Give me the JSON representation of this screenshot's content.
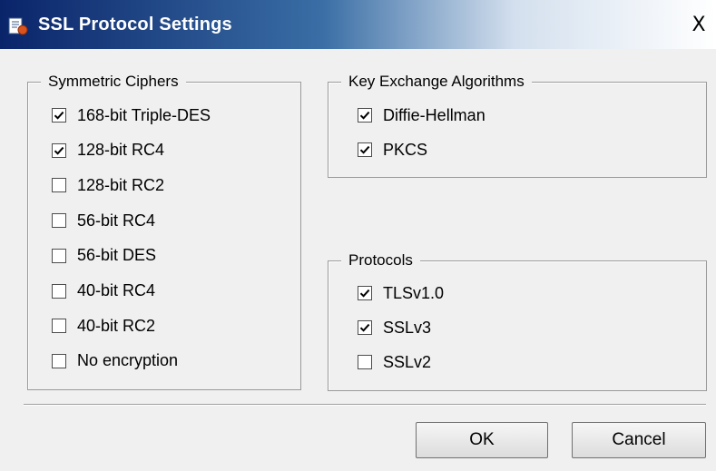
{
  "window": {
    "title": "SSL Protocol Settings",
    "close_label": "X"
  },
  "symmetric_ciphers": {
    "label": "Symmetric Ciphers",
    "options": [
      {
        "label": "168-bit Triple-DES",
        "checked": true
      },
      {
        "label": "128-bit RC4",
        "checked": true
      },
      {
        "label": "128-bit RC2",
        "checked": false
      },
      {
        "label": "56-bit RC4",
        "checked": false
      },
      {
        "label": "56-bit DES",
        "checked": false
      },
      {
        "label": "40-bit RC4",
        "checked": false
      },
      {
        "label": "40-bit RC2",
        "checked": false
      },
      {
        "label": "No encryption",
        "checked": false
      }
    ]
  },
  "key_exchange": {
    "label": "Key Exchange Algorithms",
    "options": [
      {
        "label": "Diffie-Hellman",
        "checked": true
      },
      {
        "label": "PKCS",
        "checked": true
      }
    ]
  },
  "protocols": {
    "label": "Protocols",
    "options": [
      {
        "label": "TLSv1.0",
        "checked": true
      },
      {
        "label": "SSLv3",
        "checked": true
      },
      {
        "label": "SSLv2",
        "checked": false
      }
    ]
  },
  "buttons": {
    "ok": "OK",
    "cancel": "Cancel"
  }
}
